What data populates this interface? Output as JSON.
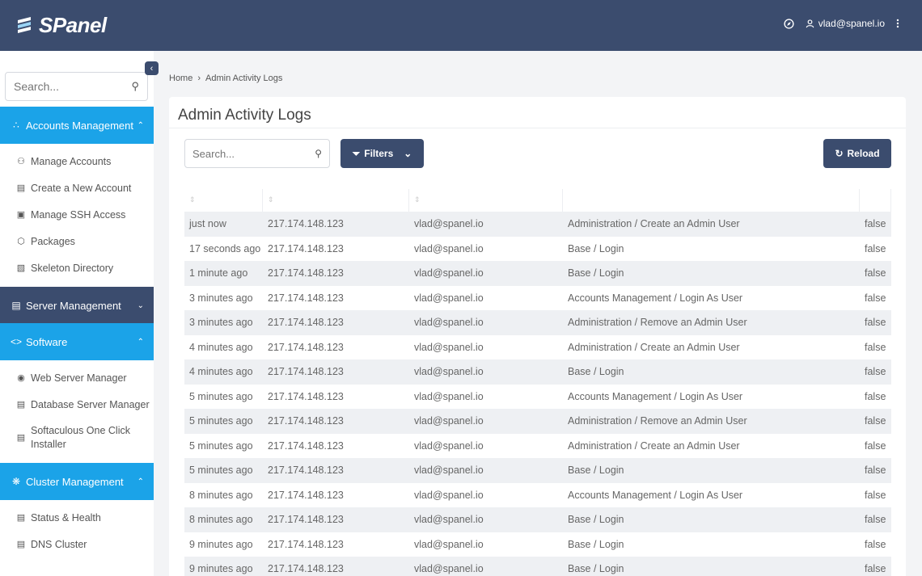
{
  "header": {
    "logo_text": "SPanel",
    "user_email": "vlad@spanel.io"
  },
  "sidebar": {
    "search_placeholder": "Search...",
    "sections": [
      {
        "label": "Accounts Management",
        "items": [
          "Manage Accounts",
          "Create a New Account",
          "Manage SSH Access",
          "Packages",
          "Skeleton Directory"
        ]
      },
      {
        "label": "Server Management",
        "items": []
      },
      {
        "label": "Software",
        "items": [
          "Web Server Manager",
          "Database Server Manager",
          "Softaculous One Click Installer"
        ]
      },
      {
        "label": "Cluster Management",
        "items": [
          "Status & Health",
          "DNS Cluster"
        ]
      }
    ]
  },
  "breadcrumb": {
    "home": "Home",
    "separator": "›",
    "current": "Admin Activity Logs"
  },
  "page": {
    "title": "Admin Activity Logs",
    "search_placeholder": "Search...",
    "filters_label": "Filters",
    "reload_label": "Reload"
  },
  "table": {
    "rows": [
      [
        "just now",
        "217.174.148.123",
        "vlad@spanel.io",
        "Administration / Create an Admin User",
        "false"
      ],
      [
        "17 seconds ago",
        "217.174.148.123",
        "vlad@spanel.io",
        "Base / Login",
        "false"
      ],
      [
        "1 minute ago",
        "217.174.148.123",
        "vlad@spanel.io",
        "Base / Login",
        "false"
      ],
      [
        "3 minutes ago",
        "217.174.148.123",
        "vlad@spanel.io",
        "Accounts Management / Login As User",
        "false"
      ],
      [
        "3 minutes ago",
        "217.174.148.123",
        "vlad@spanel.io",
        "Administration / Remove an Admin User",
        "false"
      ],
      [
        "4 minutes ago",
        "217.174.148.123",
        "vlad@spanel.io",
        "Administration / Create an Admin User",
        "false"
      ],
      [
        "4 minutes ago",
        "217.174.148.123",
        "vlad@spanel.io",
        "Base / Login",
        "false"
      ],
      [
        "5 minutes ago",
        "217.174.148.123",
        "vlad@spanel.io",
        "Accounts Management / Login As User",
        "false"
      ],
      [
        "5 minutes ago",
        "217.174.148.123",
        "vlad@spanel.io",
        "Administration / Remove an Admin User",
        "false"
      ],
      [
        "5 minutes ago",
        "217.174.148.123",
        "vlad@spanel.io",
        "Administration / Create an Admin User",
        "false"
      ],
      [
        "5 minutes ago",
        "217.174.148.123",
        "vlad@spanel.io",
        "Base / Login",
        "false"
      ],
      [
        "8 minutes ago",
        "217.174.148.123",
        "vlad@spanel.io",
        "Accounts Management / Login As User",
        "false"
      ],
      [
        "8 minutes ago",
        "217.174.148.123",
        "vlad@spanel.io",
        "Base / Login",
        "false"
      ],
      [
        "9 minutes ago",
        "217.174.148.123",
        "vlad@spanel.io",
        "Base / Login",
        "false"
      ],
      [
        "9 minutes ago",
        "217.174.148.123",
        "vlad@spanel.io",
        "Base / Login",
        "false"
      ]
    ]
  },
  "colors": {
    "header_bg": "#3b4c6e",
    "accent_blue": "#1ba3e8",
    "row_alt": "#eef0f3"
  },
  "icons": [
    "compass-icon",
    "user-icon",
    "kebab-menu-icon",
    "search-icon",
    "filter-icon",
    "reload-icon"
  ]
}
